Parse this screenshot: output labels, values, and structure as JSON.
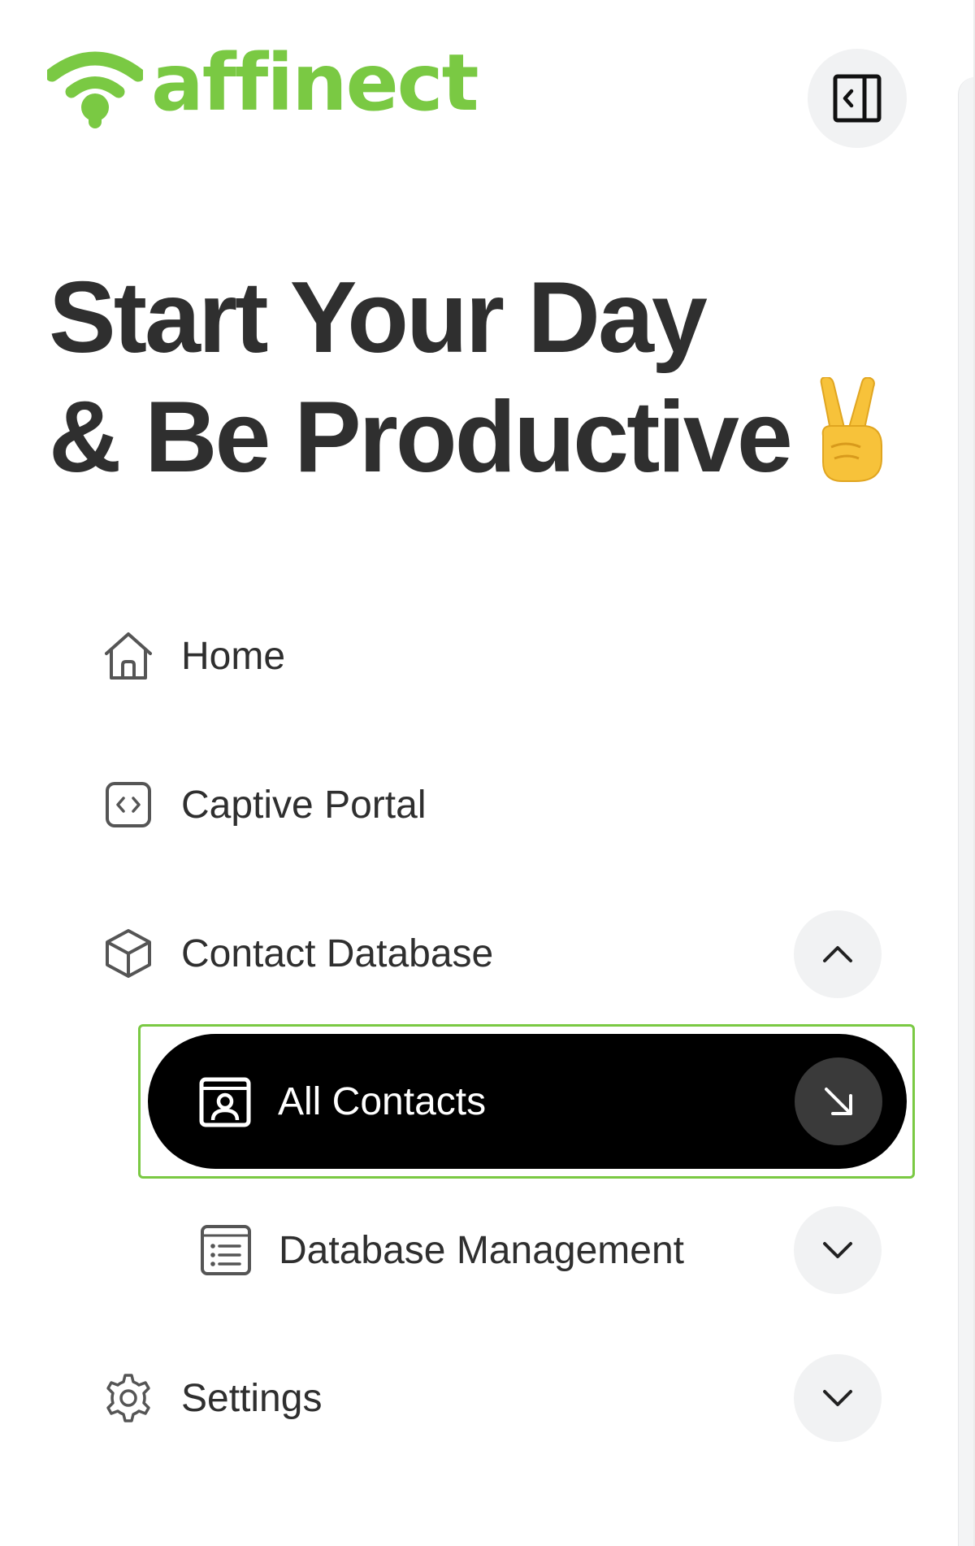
{
  "brand": {
    "name": "affinect",
    "color": "#7ac943"
  },
  "headline": {
    "line1": "Start Your Day",
    "line2": "& Be Productive",
    "emoji_icon": "victory-hand-emoji"
  },
  "sidebar": {
    "collapse_icon": "sidebar-collapse-icon",
    "items": [
      {
        "label": "Home",
        "icon": "home-icon"
      },
      {
        "label": "Captive Portal",
        "icon": "code-icon"
      },
      {
        "label": "Contact Database",
        "icon": "cube-icon",
        "expanded": true
      },
      {
        "label": "All Contacts",
        "icon": "contact-card-icon",
        "active": true
      },
      {
        "label": "Database Management",
        "icon": "list-icon",
        "expanded": false
      },
      {
        "label": "Settings",
        "icon": "gear-icon",
        "expanded": false
      }
    ]
  },
  "colors": {
    "active_bg": "#000000",
    "text": "#2f2f2f",
    "chevron_bg": "#f1f2f3",
    "active_outline": "#7ac943"
  }
}
